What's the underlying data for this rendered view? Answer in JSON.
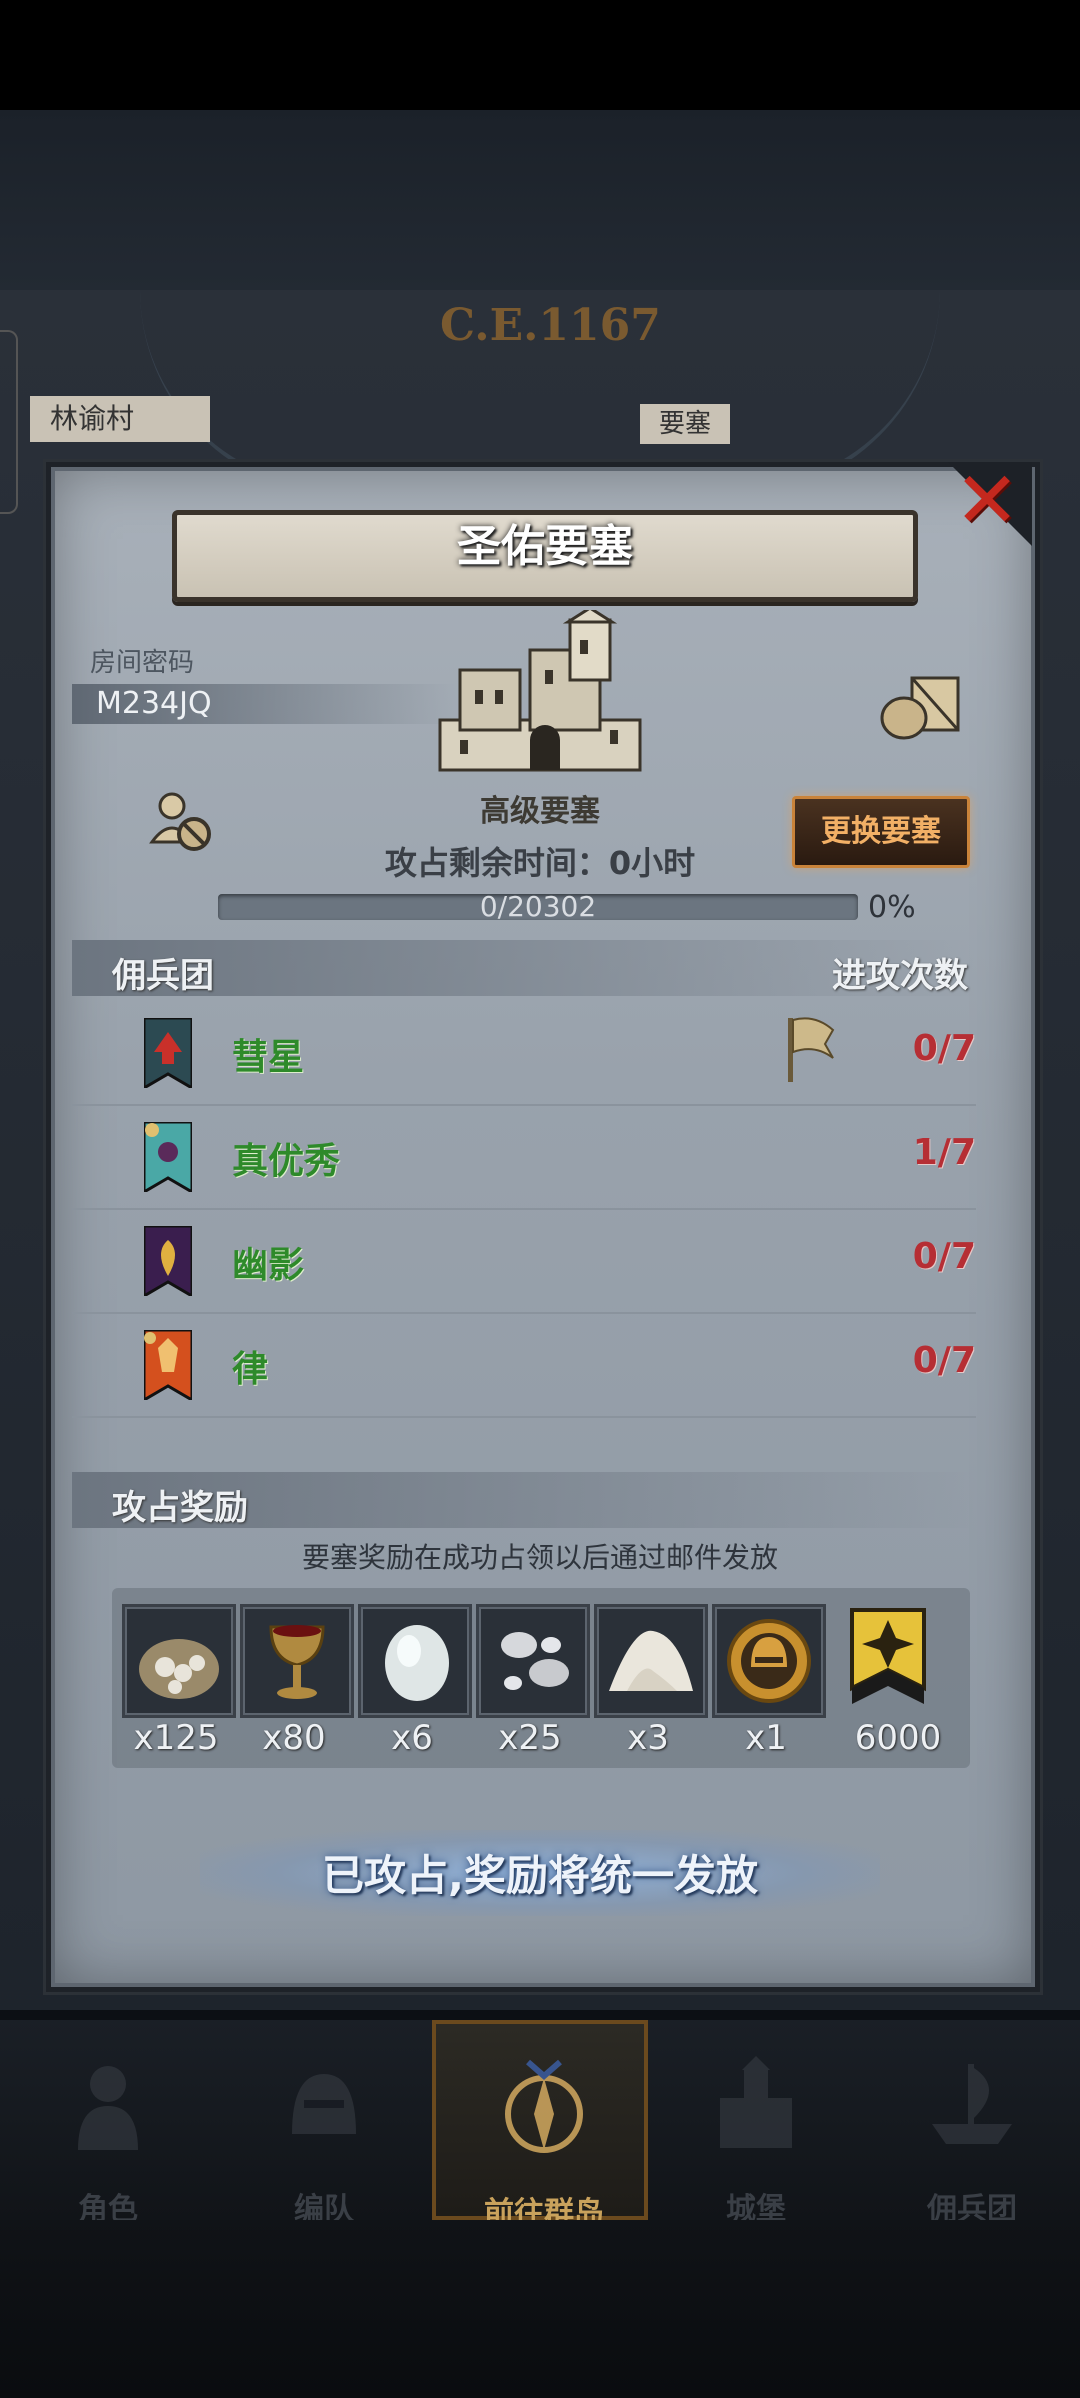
{
  "world": {
    "year": "C.E.1167",
    "village": "林谕村",
    "fort_tag": "要塞"
  },
  "dialog": {
    "title": "圣佑要塞",
    "room_label": "房间密码",
    "room_code": "M234JQ",
    "fort_level": "高级要塞",
    "timer": "攻占剩余时间：0小时",
    "change_button": "更换要塞",
    "progress": {
      "text": "0/20302",
      "current": 0,
      "total": 20302,
      "percent_label": "0%",
      "fraction": 0.0
    }
  },
  "mercenaries": {
    "header_left": "佣兵团",
    "header_right": "进攻次数",
    "rows": [
      {
        "name": "彗星",
        "count": "0/7",
        "banner": "comet-banner",
        "flag": true
      },
      {
        "name": "真优秀",
        "count": "1/7",
        "banner": "flower-banner",
        "flag": false
      },
      {
        "name": "幽影",
        "count": "0/7",
        "banner": "shadow-banner",
        "flag": false
      },
      {
        "name": "律",
        "count": "0/7",
        "banner": "law-banner",
        "flag": false
      }
    ]
  },
  "rewards": {
    "header": "攻占奖励",
    "note": "要塞奖励在成功占领以后通过邮件发放",
    "items": [
      {
        "icon": "ore-sack-icon",
        "qty": "x125"
      },
      {
        "icon": "goblet-icon",
        "qty": "x80"
      },
      {
        "icon": "stone-icon",
        "qty": "x6"
      },
      {
        "icon": "silver-pearls-icon",
        "qty": "x25"
      },
      {
        "icon": "salt-pile-icon",
        "qty": "x3"
      },
      {
        "icon": "helmet-medal-icon",
        "qty": "x1"
      },
      {
        "icon": "guild-banner-icon",
        "qty": "6000"
      }
    ]
  },
  "status": "已攻占,奖励将统一发放",
  "nav": [
    {
      "label": "角色",
      "icon": "knight-icon"
    },
    {
      "label": "编队",
      "icon": "helmet-icon"
    },
    {
      "label": "前往群岛",
      "icon": "compass-icon",
      "active": true
    },
    {
      "label": "城堡",
      "icon": "castle-icon"
    },
    {
      "label": "佣兵团",
      "icon": "ship-icon"
    }
  ],
  "colors": {
    "accent_gold": "#f2b066",
    "green_name": "#2e8a2a",
    "red_count": "#b62e34",
    "close_red": "#c4281e"
  }
}
